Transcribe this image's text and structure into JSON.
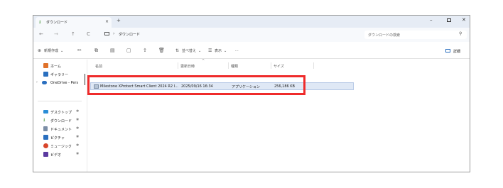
{
  "titlebar": {
    "tab_label": "ダウンロード",
    "tab_close": "×",
    "new_tab": "+",
    "minimize": "–",
    "close": "✕"
  },
  "address": {
    "crumb_separator": "›",
    "crumb": "ダウンロード",
    "search_placeholder": "ダウンロードの検索",
    "search_icon": "⚲",
    "back": "←",
    "forward": "→",
    "up": "↑",
    "refresh": "C"
  },
  "toolbar": {
    "new": "新規作成",
    "new_chevron": "⌄",
    "sort": "並べ替え",
    "sort_chevron": "⌄",
    "view": "表示",
    "view_chevron": "⌄",
    "more": "···",
    "details": "詳細"
  },
  "sidebar": {
    "items": [
      {
        "label": "ホーム",
        "color": "#e0722b"
      },
      {
        "label": "ギャラリー",
        "color": "#2a6fbf"
      },
      {
        "label": "OneDrive - Pers",
        "color": "#2a6fbf"
      },
      {
        "label": "デスクトップ",
        "color": "#2a8dd6"
      },
      {
        "label": "ダウンロード",
        "color": "#3d8f2e"
      },
      {
        "label": "ドキュメント",
        "color": "#7b8ea6"
      },
      {
        "label": "ピクチャ",
        "color": "#2a6fbf"
      },
      {
        "label": "ミュージック",
        "color": "#d8452b"
      },
      {
        "label": "ビデオ",
        "color": "#5b3aa0"
      }
    ],
    "pin": "✱",
    "expand": "›"
  },
  "columns": {
    "name": "名前",
    "date": "更新日時",
    "type": "種類",
    "size": "サイズ",
    "sort_indicator": "^"
  },
  "files": [
    {
      "name": "Milestone XProtect Smart Client 2024 R2 I...",
      "date": "2025/09/16 16:34",
      "type": "アプリケーション",
      "size": "256,186 KB"
    }
  ],
  "colors": {
    "highlight": "#ef2b2b",
    "selection": "#dfe8f5"
  }
}
